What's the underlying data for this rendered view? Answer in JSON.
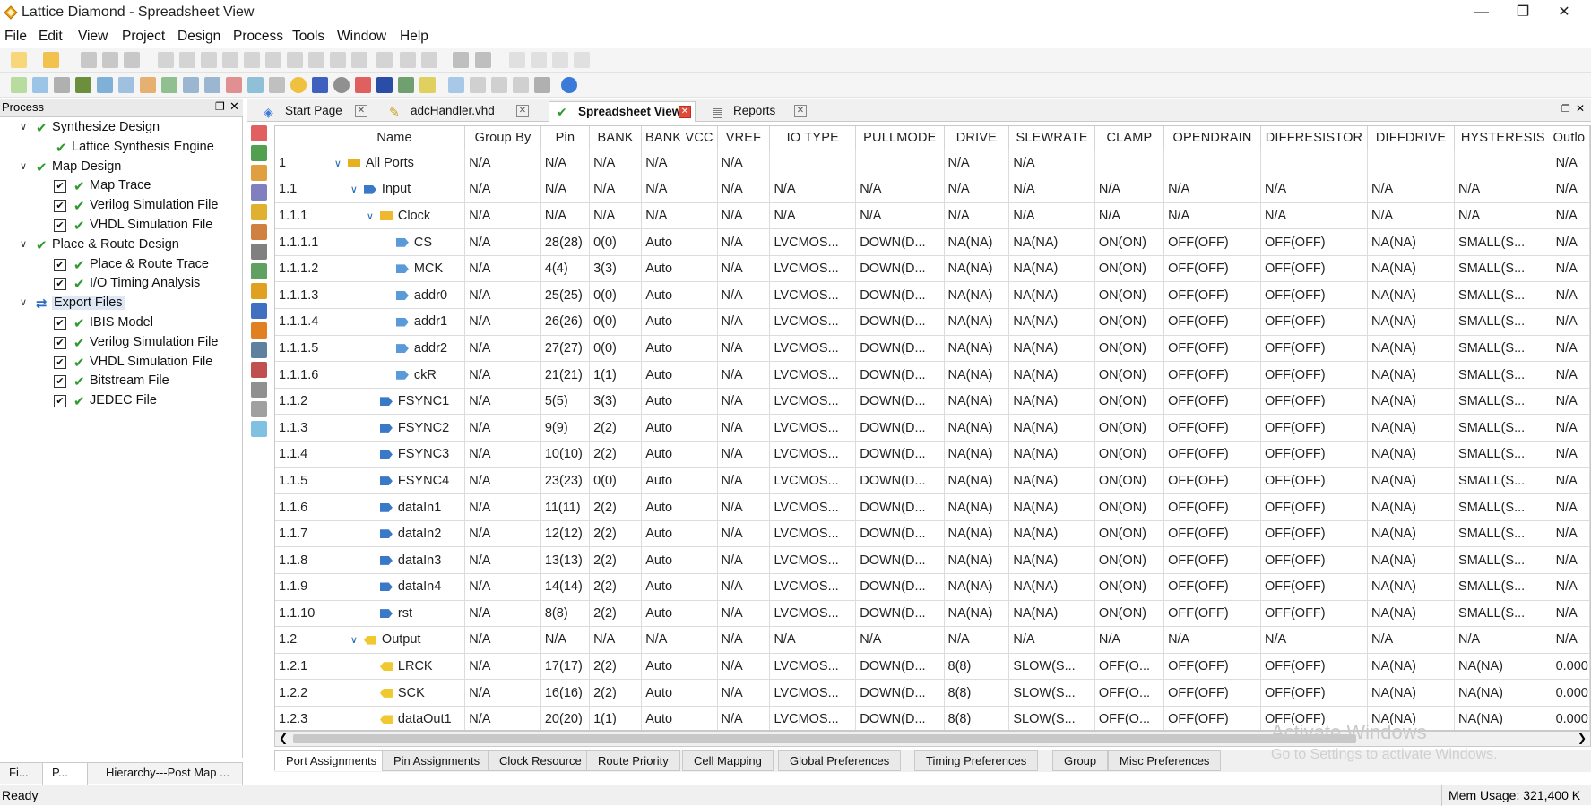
{
  "window": {
    "title": "Lattice Diamond - Spreadsheet View"
  },
  "menu": [
    "File",
    "Edit",
    "View",
    "Project",
    "Design",
    "Process",
    "Tools",
    "Window",
    "Help"
  ],
  "process_panel": {
    "title": "Process",
    "items": [
      {
        "label": "Synthesize Design",
        "level": 0,
        "type": "group"
      },
      {
        "label": "Lattice Synthesis Engine",
        "level": 1,
        "type": "step"
      },
      {
        "label": "Map Design",
        "level": 0,
        "type": "group"
      },
      {
        "label": "Map Trace",
        "level": 1,
        "type": "check"
      },
      {
        "label": "Verilog Simulation File",
        "level": 1,
        "type": "check"
      },
      {
        "label": "VHDL Simulation File",
        "level": 1,
        "type": "check"
      },
      {
        "label": "Place & Route Design",
        "level": 0,
        "type": "group"
      },
      {
        "label": "Place & Route Trace",
        "level": 1,
        "type": "check"
      },
      {
        "label": "I/O Timing Analysis",
        "level": 1,
        "type": "check"
      },
      {
        "label": "Export Files",
        "level": 0,
        "type": "group-selected"
      },
      {
        "label": "IBIS Model",
        "level": 1,
        "type": "check"
      },
      {
        "label": "Verilog Simulation File",
        "level": 1,
        "type": "check"
      },
      {
        "label": "VHDL Simulation File",
        "level": 1,
        "type": "check"
      },
      {
        "label": "Bitstream File",
        "level": 1,
        "type": "check"
      },
      {
        "label": "JEDEC File",
        "level": 1,
        "type": "check"
      }
    ],
    "bottom_tabs": [
      "Fi...",
      "P...",
      "Hierarchy---Post Map ..."
    ]
  },
  "doc_tabs": [
    "Start Page",
    "adcHandler.vhd",
    "Spreadsheet View",
    "Reports"
  ],
  "sheet": {
    "columns": [
      "",
      "Name",
      "Group By",
      "Pin",
      "BANK",
      "BANK VCC",
      "VREF",
      "IO TYPE",
      "PULLMODE",
      "DRIVE",
      "SLEWRATE",
      "CLAMP",
      "OPENDRAIN",
      "DIFFRESISTOR",
      "DIFFDRIVE",
      "HYSTERESIS",
      "Outlo"
    ],
    "rows": [
      {
        "idx": "1",
        "name": "All Ports",
        "level": 0,
        "tog": "v",
        "icon": "allports",
        "cells": [
          "N/A",
          "N/A",
          "N/A",
          "N/A",
          "N/A",
          "",
          "",
          "N/A",
          "N/A",
          "",
          "",
          "",
          "",
          "",
          "N/A"
        ]
      },
      {
        "idx": "1.1",
        "name": "Input",
        "level": 1,
        "tog": "v",
        "icon": "input",
        "cells": [
          "N/A",
          "N/A",
          "N/A",
          "N/A",
          "N/A",
          "N/A",
          "N/A",
          "N/A",
          "N/A",
          "N/A",
          "N/A",
          "N/A",
          "N/A",
          "N/A",
          "N/A"
        ]
      },
      {
        "idx": "1.1.1",
        "name": "Clock",
        "level": 2,
        "tog": "v",
        "icon": "folder",
        "cells": [
          "N/A",
          "N/A",
          "N/A",
          "N/A",
          "N/A",
          "N/A",
          "N/A",
          "N/A",
          "N/A",
          "N/A",
          "N/A",
          "N/A",
          "N/A",
          "N/A",
          "N/A"
        ]
      },
      {
        "idx": "1.1.1.1",
        "name": "CS",
        "level": 3,
        "tog": "",
        "icon": "clockpin",
        "cells": [
          "N/A",
          "28(28)",
          "0(0)",
          "Auto",
          "N/A",
          "LVCMOS...",
          "DOWN(D...",
          "NA(NA)",
          "NA(NA)",
          "ON(ON)",
          "OFF(OFF)",
          "OFF(OFF)",
          "NA(NA)",
          "SMALL(S...",
          "N/A"
        ]
      },
      {
        "idx": "1.1.1.2",
        "name": "MCK",
        "level": 3,
        "tog": "",
        "icon": "clockpin",
        "cells": [
          "N/A",
          "4(4)",
          "3(3)",
          "Auto",
          "N/A",
          "LVCMOS...",
          "DOWN(D...",
          "NA(NA)",
          "NA(NA)",
          "ON(ON)",
          "OFF(OFF)",
          "OFF(OFF)",
          "NA(NA)",
          "SMALL(S...",
          "N/A"
        ]
      },
      {
        "idx": "1.1.1.3",
        "name": "addr0",
        "level": 3,
        "tog": "",
        "icon": "clockpin",
        "cells": [
          "N/A",
          "25(25)",
          "0(0)",
          "Auto",
          "N/A",
          "LVCMOS...",
          "DOWN(D...",
          "NA(NA)",
          "NA(NA)",
          "ON(ON)",
          "OFF(OFF)",
          "OFF(OFF)",
          "NA(NA)",
          "SMALL(S...",
          "N/A"
        ]
      },
      {
        "idx": "1.1.1.4",
        "name": "addr1",
        "level": 3,
        "tog": "",
        "icon": "clockpin",
        "cells": [
          "N/A",
          "26(26)",
          "0(0)",
          "Auto",
          "N/A",
          "LVCMOS...",
          "DOWN(D...",
          "NA(NA)",
          "NA(NA)",
          "ON(ON)",
          "OFF(OFF)",
          "OFF(OFF)",
          "NA(NA)",
          "SMALL(S...",
          "N/A"
        ]
      },
      {
        "idx": "1.1.1.5",
        "name": "addr2",
        "level": 3,
        "tog": "",
        "icon": "clockpin",
        "cells": [
          "N/A",
          "27(27)",
          "0(0)",
          "Auto",
          "N/A",
          "LVCMOS...",
          "DOWN(D...",
          "NA(NA)",
          "NA(NA)",
          "ON(ON)",
          "OFF(OFF)",
          "OFF(OFF)",
          "NA(NA)",
          "SMALL(S...",
          "N/A"
        ]
      },
      {
        "idx": "1.1.1.6",
        "name": "ckR",
        "level": 3,
        "tog": "",
        "icon": "clockpin",
        "cells": [
          "N/A",
          "21(21)",
          "1(1)",
          "Auto",
          "N/A",
          "LVCMOS...",
          "DOWN(D...",
          "NA(NA)",
          "NA(NA)",
          "ON(ON)",
          "OFF(OFF)",
          "OFF(OFF)",
          "NA(NA)",
          "SMALL(S...",
          "N/A"
        ]
      },
      {
        "idx": "1.1.2",
        "name": "FSYNC1",
        "level": 2,
        "tog": "",
        "icon": "inpin",
        "cells": [
          "N/A",
          "5(5)",
          "3(3)",
          "Auto",
          "N/A",
          "LVCMOS...",
          "DOWN(D...",
          "NA(NA)",
          "NA(NA)",
          "ON(ON)",
          "OFF(OFF)",
          "OFF(OFF)",
          "NA(NA)",
          "SMALL(S...",
          "N/A"
        ]
      },
      {
        "idx": "1.1.3",
        "name": "FSYNC2",
        "level": 2,
        "tog": "",
        "icon": "inpin",
        "cells": [
          "N/A",
          "9(9)",
          "2(2)",
          "Auto",
          "N/A",
          "LVCMOS...",
          "DOWN(D...",
          "NA(NA)",
          "NA(NA)",
          "ON(ON)",
          "OFF(OFF)",
          "OFF(OFF)",
          "NA(NA)",
          "SMALL(S...",
          "N/A"
        ]
      },
      {
        "idx": "1.1.4",
        "name": "FSYNC3",
        "level": 2,
        "tog": "",
        "icon": "inpin",
        "cells": [
          "N/A",
          "10(10)",
          "2(2)",
          "Auto",
          "N/A",
          "LVCMOS...",
          "DOWN(D...",
          "NA(NA)",
          "NA(NA)",
          "ON(ON)",
          "OFF(OFF)",
          "OFF(OFF)",
          "NA(NA)",
          "SMALL(S...",
          "N/A"
        ]
      },
      {
        "idx": "1.1.5",
        "name": "FSYNC4",
        "level": 2,
        "tog": "",
        "icon": "inpin",
        "cells": [
          "N/A",
          "23(23)",
          "0(0)",
          "Auto",
          "N/A",
          "LVCMOS...",
          "DOWN(D...",
          "NA(NA)",
          "NA(NA)",
          "ON(ON)",
          "OFF(OFF)",
          "OFF(OFF)",
          "NA(NA)",
          "SMALL(S...",
          "N/A"
        ]
      },
      {
        "idx": "1.1.6",
        "name": "dataIn1",
        "level": 2,
        "tog": "",
        "icon": "inpin",
        "cells": [
          "N/A",
          "11(11)",
          "2(2)",
          "Auto",
          "N/A",
          "LVCMOS...",
          "DOWN(D...",
          "NA(NA)",
          "NA(NA)",
          "ON(ON)",
          "OFF(OFF)",
          "OFF(OFF)",
          "NA(NA)",
          "SMALL(S...",
          "N/A"
        ]
      },
      {
        "idx": "1.1.7",
        "name": "dataIn2",
        "level": 2,
        "tog": "",
        "icon": "inpin",
        "cells": [
          "N/A",
          "12(12)",
          "2(2)",
          "Auto",
          "N/A",
          "LVCMOS...",
          "DOWN(D...",
          "NA(NA)",
          "NA(NA)",
          "ON(ON)",
          "OFF(OFF)",
          "OFF(OFF)",
          "NA(NA)",
          "SMALL(S...",
          "N/A"
        ]
      },
      {
        "idx": "1.1.8",
        "name": "dataIn3",
        "level": 2,
        "tog": "",
        "icon": "inpin",
        "cells": [
          "N/A",
          "13(13)",
          "2(2)",
          "Auto",
          "N/A",
          "LVCMOS...",
          "DOWN(D...",
          "NA(NA)",
          "NA(NA)",
          "ON(ON)",
          "OFF(OFF)",
          "OFF(OFF)",
          "NA(NA)",
          "SMALL(S...",
          "N/A"
        ]
      },
      {
        "idx": "1.1.9",
        "name": "dataIn4",
        "level": 2,
        "tog": "",
        "icon": "inpin",
        "cells": [
          "N/A",
          "14(14)",
          "2(2)",
          "Auto",
          "N/A",
          "LVCMOS...",
          "DOWN(D...",
          "NA(NA)",
          "NA(NA)",
          "ON(ON)",
          "OFF(OFF)",
          "OFF(OFF)",
          "NA(NA)",
          "SMALL(S...",
          "N/A"
        ]
      },
      {
        "idx": "1.1.10",
        "name": "rst",
        "level": 2,
        "tog": "",
        "icon": "inpin",
        "cells": [
          "N/A",
          "8(8)",
          "2(2)",
          "Auto",
          "N/A",
          "LVCMOS...",
          "DOWN(D...",
          "NA(NA)",
          "NA(NA)",
          "ON(ON)",
          "OFF(OFF)",
          "OFF(OFF)",
          "NA(NA)",
          "SMALL(S...",
          "N/A"
        ]
      },
      {
        "idx": "1.2",
        "name": "Output",
        "level": 1,
        "tog": "v",
        "icon": "output",
        "cells": [
          "N/A",
          "N/A",
          "N/A",
          "N/A",
          "N/A",
          "N/A",
          "N/A",
          "N/A",
          "N/A",
          "N/A",
          "N/A",
          "N/A",
          "N/A",
          "N/A",
          "N/A"
        ]
      },
      {
        "idx": "1.2.1",
        "name": "LRCK",
        "level": 2,
        "tog": "",
        "icon": "outpin",
        "cells": [
          "N/A",
          "17(17)",
          "2(2)",
          "Auto",
          "N/A",
          "LVCMOS...",
          "DOWN(D...",
          "8(8)",
          "SLOW(S...",
          "OFF(O...",
          "OFF(OFF)",
          "OFF(OFF)",
          "NA(NA)",
          "NA(NA)",
          "0.000"
        ]
      },
      {
        "idx": "1.2.2",
        "name": "SCK",
        "level": 2,
        "tog": "",
        "icon": "outpin",
        "cells": [
          "N/A",
          "16(16)",
          "2(2)",
          "Auto",
          "N/A",
          "LVCMOS...",
          "DOWN(D...",
          "8(8)",
          "SLOW(S...",
          "OFF(O...",
          "OFF(OFF)",
          "OFF(OFF)",
          "NA(NA)",
          "NA(NA)",
          "0.000"
        ]
      },
      {
        "idx": "1.2.3",
        "name": "dataOut1",
        "level": 2,
        "tog": "",
        "icon": "outpin",
        "cells": [
          "N/A",
          "20(20)",
          "1(1)",
          "Auto",
          "N/A",
          "LVCMOS...",
          "DOWN(D...",
          "8(8)",
          "SLOW(S...",
          "OFF(O...",
          "OFF(OFF)",
          "OFF(OFF)",
          "NA(NA)",
          "NA(NA)",
          "0.000"
        ]
      }
    ]
  },
  "sheet_tabs": [
    "Port Assignments",
    "Pin Assignments",
    "Clock Resource",
    "Route Priority",
    "Cell Mapping",
    "Global Preferences",
    "Timing Preferences",
    "Group",
    "Misc Preferences"
  ],
  "status": {
    "left": "Ready",
    "mem": "Mem Usage:  321,400 K"
  },
  "watermark": {
    "line1": "Activate Windows",
    "line2": "Go to Settings to activate Windows."
  },
  "colors": {
    "accent_green": "#1e7a3c",
    "accent_blue": "#1a3fd6",
    "gray_text": "#8a8a8a",
    "selected_tab_close": "#e04b3a"
  }
}
